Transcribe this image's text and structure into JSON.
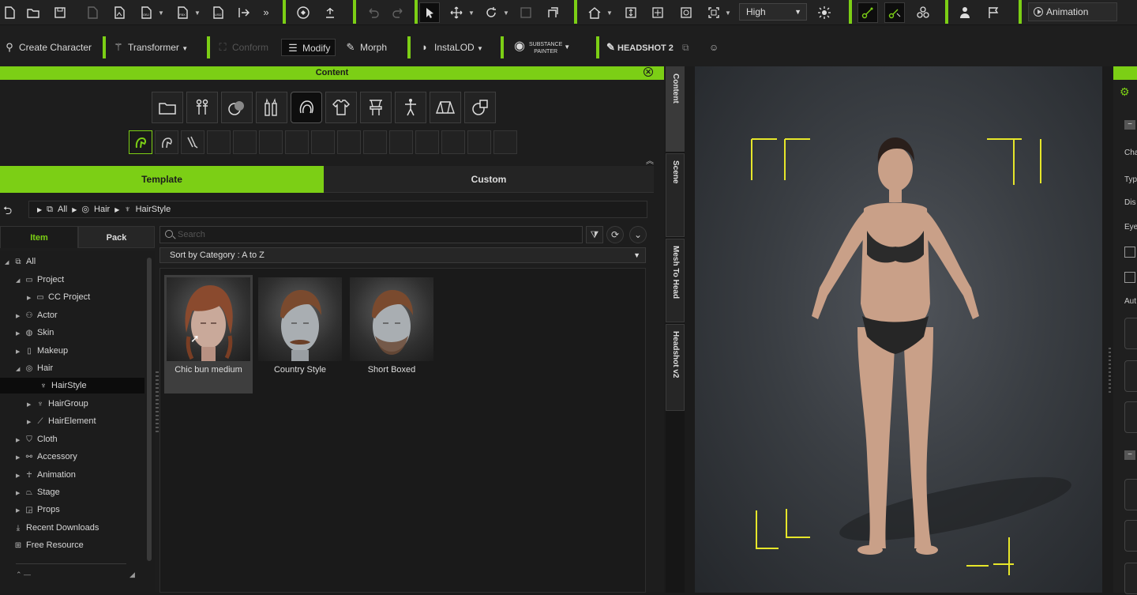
{
  "toolbar": {
    "quality_dropdown": "High",
    "animation_player_label": "Animation Player"
  },
  "toolbar2": {
    "create_character": "Create Character",
    "transformer": "Transformer",
    "conform": "Conform",
    "modify": "Modify",
    "morph": "Morph",
    "instalod": "InstaLOD",
    "substance_painter_line1": "SUBSTANCE",
    "substance_painter_line2": "PAINTER",
    "headshot2": "HEADSHOT 2"
  },
  "content_panel": {
    "title": "Content",
    "tabs": {
      "template": "Template",
      "custom": "Custom"
    },
    "breadcrumb": [
      "All",
      "Hair",
      "HairStyle"
    ],
    "left_tabs": {
      "item": "Item",
      "pack": "Pack"
    },
    "search_placeholder": "Search",
    "sort_label": "Sort by Category : A to Z",
    "tree": [
      {
        "label": "All"
      },
      {
        "label": "Project"
      },
      {
        "label": "CC Project"
      },
      {
        "label": "Actor"
      },
      {
        "label": "Skin"
      },
      {
        "label": "Makeup"
      },
      {
        "label": "Hair"
      },
      {
        "label": "HairStyle"
      },
      {
        "label": "HairGroup"
      },
      {
        "label": "HairElement"
      },
      {
        "label": "Cloth"
      },
      {
        "label": "Accessory"
      },
      {
        "label": "Animation"
      },
      {
        "label": "Stage"
      },
      {
        "label": "Props"
      },
      {
        "label": "Recent Downloads"
      },
      {
        "label": "Free Resource"
      }
    ],
    "items": [
      {
        "label": "Chic bun medium"
      },
      {
        "label": "Country Style"
      },
      {
        "label": "Short Boxed"
      }
    ]
  },
  "side_tabs": [
    "Content",
    "Scene",
    "Mesh To Head",
    "Headshot v2"
  ],
  "right_panel": {
    "labels": [
      "Cha",
      "Typ",
      "Dis",
      "Eye",
      "Aut"
    ]
  },
  "colors": {
    "accent": "#7ccf15",
    "frame_marker": "#e6e62a"
  }
}
